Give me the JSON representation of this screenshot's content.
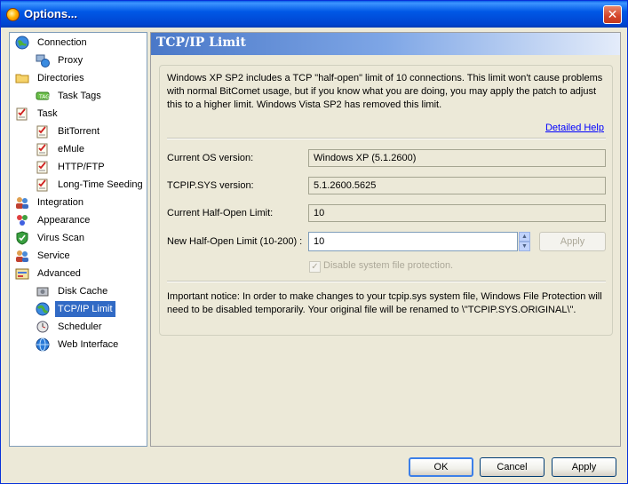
{
  "window": {
    "title": "Options...",
    "close_glyph": "✕"
  },
  "tree": [
    {
      "label": "Connection",
      "icon": "globe-icon",
      "level": 0
    },
    {
      "label": "Proxy",
      "icon": "network-icon",
      "level": 1
    },
    {
      "label": "Directories",
      "icon": "folder-icon",
      "level": 0
    },
    {
      "label": "Task Tags",
      "icon": "tag-icon",
      "level": 1
    },
    {
      "label": "Task",
      "icon": "checklist-icon",
      "level": 0
    },
    {
      "label": "BitTorrent",
      "icon": "checklist-icon",
      "level": 1
    },
    {
      "label": "eMule",
      "icon": "checklist-icon",
      "level": 1
    },
    {
      "label": "HTTP/FTP",
      "icon": "checklist-icon",
      "level": 1
    },
    {
      "label": "Long-Time Seeding",
      "icon": "checklist-icon",
      "level": 1
    },
    {
      "label": "Integration",
      "icon": "users-icon",
      "level": 0
    },
    {
      "label": "Appearance",
      "icon": "palette-icon",
      "level": 0
    },
    {
      "label": "Virus Scan",
      "icon": "shield-icon",
      "level": 0
    },
    {
      "label": "Service",
      "icon": "users-icon",
      "level": 0
    },
    {
      "label": "Advanced",
      "icon": "advanced-icon",
      "level": 0
    },
    {
      "label": "Disk Cache",
      "icon": "disk-icon",
      "level": 1
    },
    {
      "label": "TCP/IP Limit",
      "icon": "network-globe-icon",
      "level": 1,
      "selected": true
    },
    {
      "label": "Scheduler",
      "icon": "scheduler-icon",
      "level": 1
    },
    {
      "label": "Web Interface",
      "icon": "web-icon",
      "level": 1
    }
  ],
  "panel": {
    "title": "TCP/IP Limit",
    "description": "Windows XP SP2 includes a TCP \"half-open\" limit of 10 connections. This limit won't cause problems with normal BitComet usage, but if you know what you are doing, you may apply the patch to adjust this to a higher limit. Windows Vista SP2 has removed this limit.",
    "help_link": "Detailed Help",
    "os_label": "Current OS version:",
    "os_value": "Windows XP (5.1.2600)",
    "tcpip_label": "TCPIP.SYS version:",
    "tcpip_value": "5.1.2600.5625",
    "half_open_label": "Current Half-Open Limit:",
    "half_open_value": "10",
    "new_limit_label": "New Half-Open Limit (10-200) :",
    "new_limit_value": "10",
    "apply_inner_label": "Apply",
    "checkbox_label": "Disable system file protection.",
    "checkbox_checked": true,
    "notice": "Important notice: In order to make changes to your tcpip.sys system file, Windows File Protection will need to be disabled temporarily. Your original file will be renamed to \\\"TCPIP.SYS.ORIGINAL\\\"."
  },
  "buttons": {
    "ok": "OK",
    "cancel": "Cancel",
    "apply": "Apply"
  },
  "colors": {
    "selection": "#316ac5",
    "titlebar": "#0054e3",
    "link": "#0000ff"
  }
}
